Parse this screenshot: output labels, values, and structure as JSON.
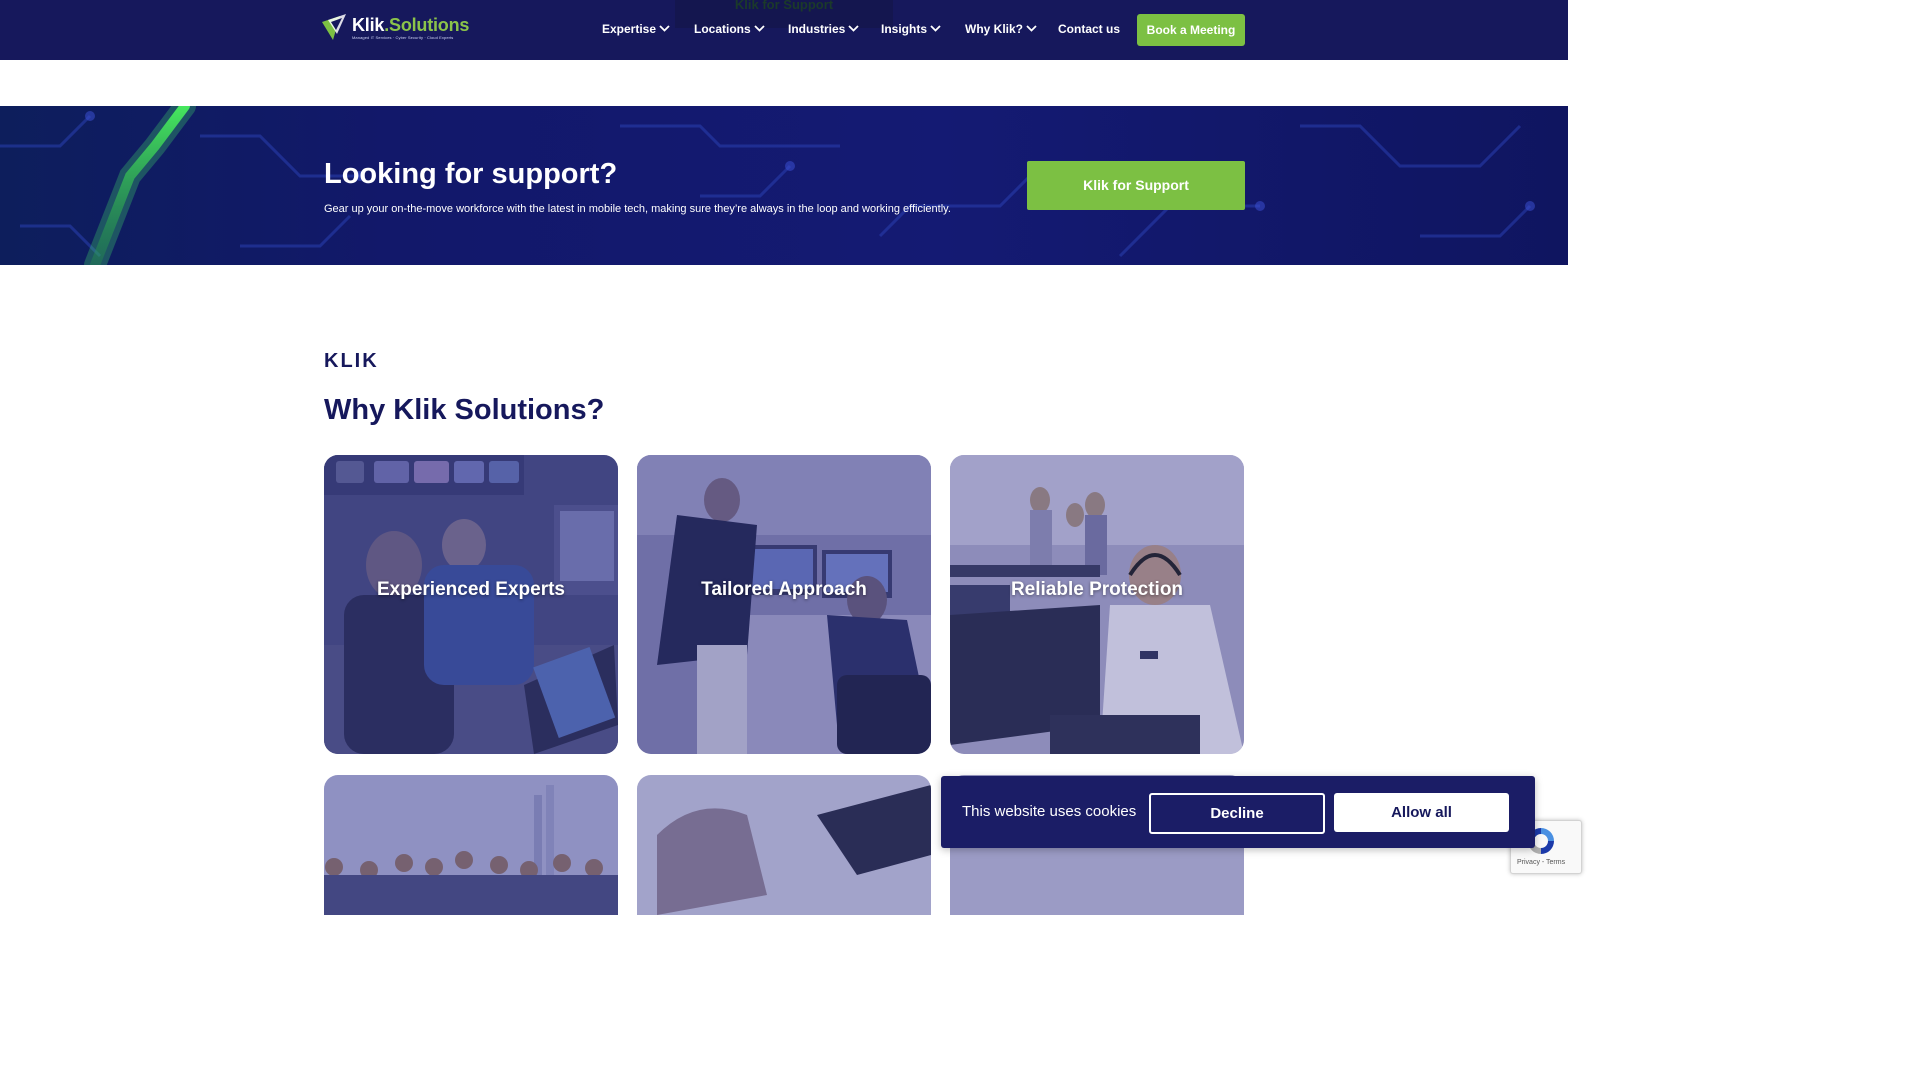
{
  "header": {
    "logo": {
      "name": "Klik",
      "dot_name": ".Solutions",
      "tagline": "Managed IT Services · Cyber Security · Cloud Experts"
    },
    "ghost_button_label": "Klik for Support",
    "nav": [
      {
        "label": "Expertise",
        "has_dropdown": true
      },
      {
        "label": "Locations",
        "has_dropdown": true
      },
      {
        "label": "Industries",
        "has_dropdown": true
      },
      {
        "label": "Insights",
        "has_dropdown": true
      },
      {
        "label": "Why Klik?",
        "has_dropdown": true
      },
      {
        "label": "Contact us",
        "has_dropdown": false
      }
    ],
    "cta_label": "Book a Meeting"
  },
  "banner": {
    "title": "Looking for support?",
    "subtitle": "Gear up your on-the-move workforce with the latest in mobile tech, making sure they’re always in the loop and working efficiently.",
    "button_label": "Klik for Support"
  },
  "why": {
    "eyebrow": "KLIK",
    "title": "Why Klik Solutions?",
    "cards": [
      {
        "title": "Experienced Experts"
      },
      {
        "title": "Tailored Approach"
      },
      {
        "title": "Reliable Protection"
      }
    ]
  },
  "cookie_bar": {
    "message": "This website uses cookies",
    "decline_label": "Decline",
    "allow_label": "Allow all"
  },
  "recaptcha": {
    "links": "Privacy - Terms"
  },
  "colors": {
    "navy": "#16185c",
    "green": "#7cc043",
    "white": "#ffffff"
  },
  "icons": {
    "logo": "klik-logo-mark",
    "dropdown": "chevron-down-icon",
    "recaptcha": "recaptcha-icon"
  }
}
